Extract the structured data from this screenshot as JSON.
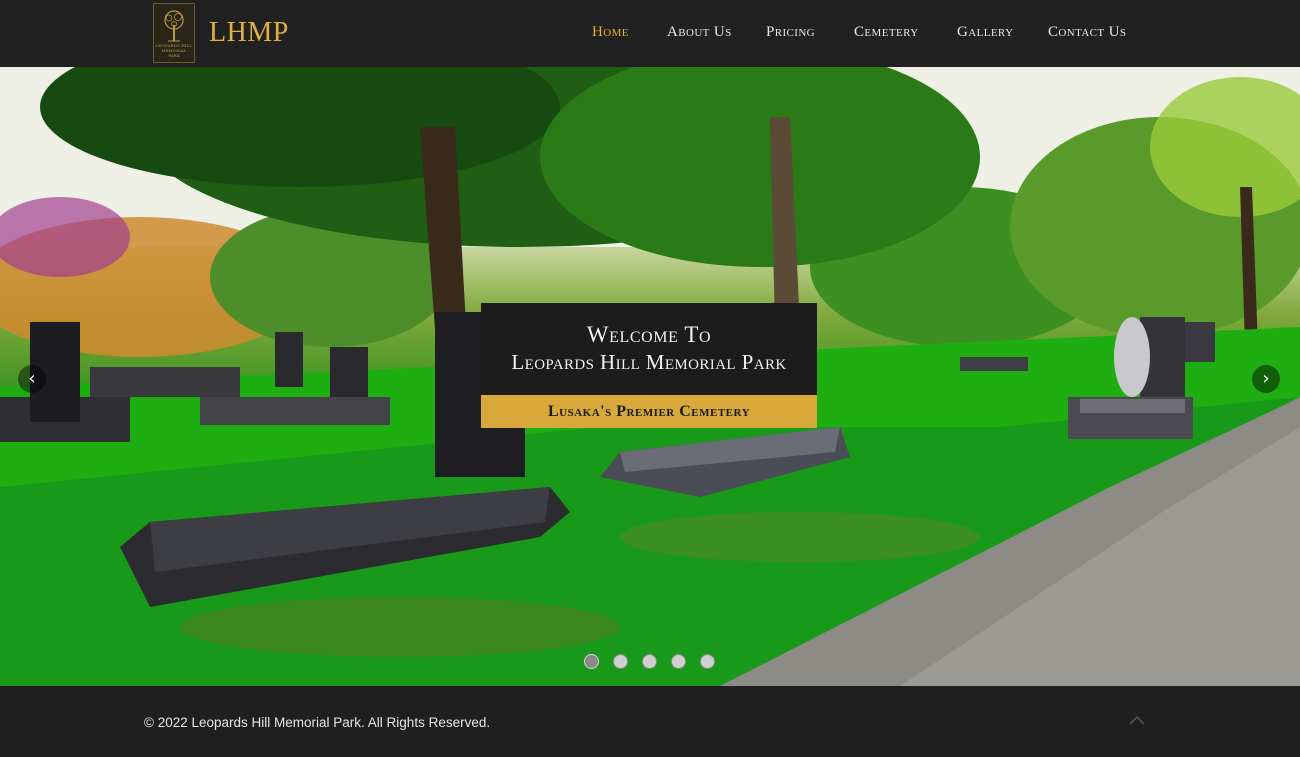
{
  "brand": {
    "name": "LHMP",
    "logo_text": "LEOPARDS HILL MEMORIAL PARK",
    "logo_icon": "tree-emblem-icon"
  },
  "nav": {
    "items": [
      {
        "label": "Home",
        "active": true
      },
      {
        "label": "About Us",
        "active": false
      },
      {
        "label": "Pricing",
        "active": false
      },
      {
        "label": "Cemetery",
        "active": false
      },
      {
        "label": "Gallery",
        "active": false
      },
      {
        "label": "Contact Us",
        "active": false
      }
    ]
  },
  "hero": {
    "title": "Welcome To",
    "subtitle": "Leopards Hill Memorial Park",
    "tagline": "Lusaka's Premier Cemetery",
    "prev_icon": "chevron-left-icon",
    "next_icon": "chevron-right-icon",
    "prev_glyph": "‹",
    "next_glyph": "›",
    "slide_count": 5,
    "active_slide": 1
  },
  "footer": {
    "copyright": "© 2022 Leopards Hill Memorial Park. All Rights Reserved.",
    "top_icon": "chevron-up-icon"
  },
  "colors": {
    "accent": "#e0b13e",
    "header_bg": "#212121",
    "caption_bar": "#d9a83a"
  }
}
